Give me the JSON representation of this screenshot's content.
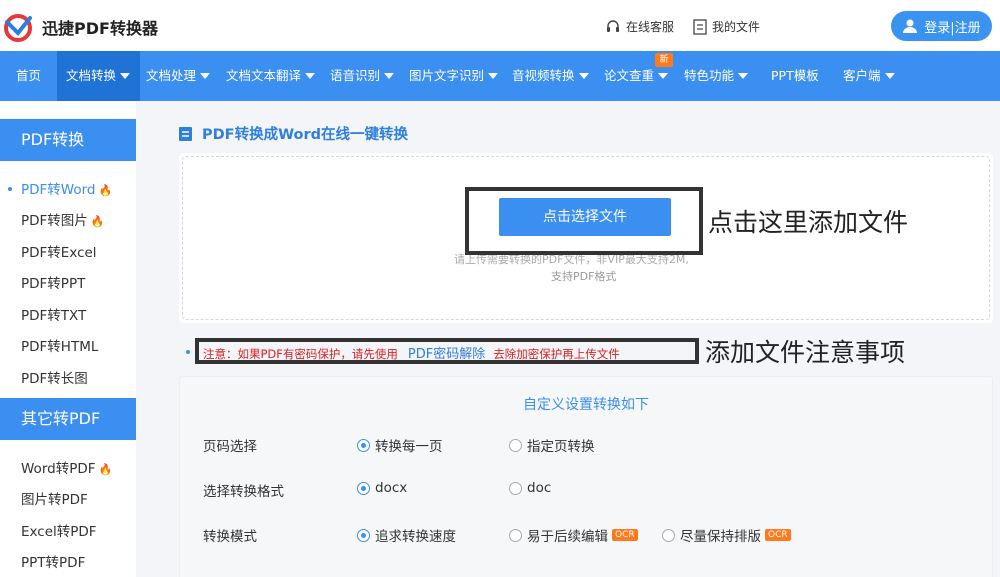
{
  "header": {
    "brand": "迅捷PDF转换器",
    "service_label": "在线客服",
    "files_label": "我的文件",
    "login_label": "登录|注册",
    "icons": [
      "logo-icon",
      "headset-icon",
      "file-icon",
      "user-icon"
    ]
  },
  "nav": {
    "items": [
      {
        "label": "首页"
      },
      {
        "label": "文档转换"
      },
      {
        "label": "文档处理"
      },
      {
        "label": "文档文本翻译"
      },
      {
        "label": "语音识别"
      },
      {
        "label": "图片文字识别"
      },
      {
        "label": "音视频转换"
      },
      {
        "label": "论文查重"
      },
      {
        "label": "特色功能"
      },
      {
        "label": "PPT模板"
      },
      {
        "label": "客户端"
      }
    ],
    "new_badge": "新"
  },
  "sidebar": {
    "section1": "PDF转换",
    "items1": [
      "PDF转Word",
      "PDF转图片",
      "PDF转Excel",
      "PDF转PPT",
      "PDF转TXT",
      "PDF转HTML",
      "PDF转长图"
    ],
    "section2": "其它转PDF",
    "items2": [
      "Word转PDF",
      "图片转PDF",
      "Excel转PDF",
      "PPT转PDF"
    ]
  },
  "main": {
    "title": "PDF转换成Word在线一键转换",
    "choose_label": "点击选择文件",
    "hint_line1": "请上传需要转换的PDF文件，非VIP最大支持2M,",
    "hint_line2": "支持PDF格式",
    "annotation1": "点击这里添加文件",
    "notice_pre": "注意：如果PDF有密码保护，请先使用",
    "notice_link": "PDF密码解除",
    "notice_post": "去除加密保护再上传文件",
    "annotation2": "添加文件注意事项"
  },
  "settings": {
    "title": "自定义设置转换如下",
    "rows": [
      {
        "label": "页码选择",
        "options": [
          "转换每一页",
          "指定页转换"
        ]
      },
      {
        "label": "选择转换格式",
        "options": [
          "docx",
          "doc"
        ]
      },
      {
        "label": "转换模式",
        "options": [
          "追求转换速度",
          "易于后续编辑",
          "尽量保持排版"
        ]
      }
    ],
    "ocr_label": "OCR"
  },
  "colors": {
    "accent": "#3b8ff0",
    "active_nav": "#1f72d6",
    "warning": "#e02020",
    "badge": "#ff7a1a"
  }
}
